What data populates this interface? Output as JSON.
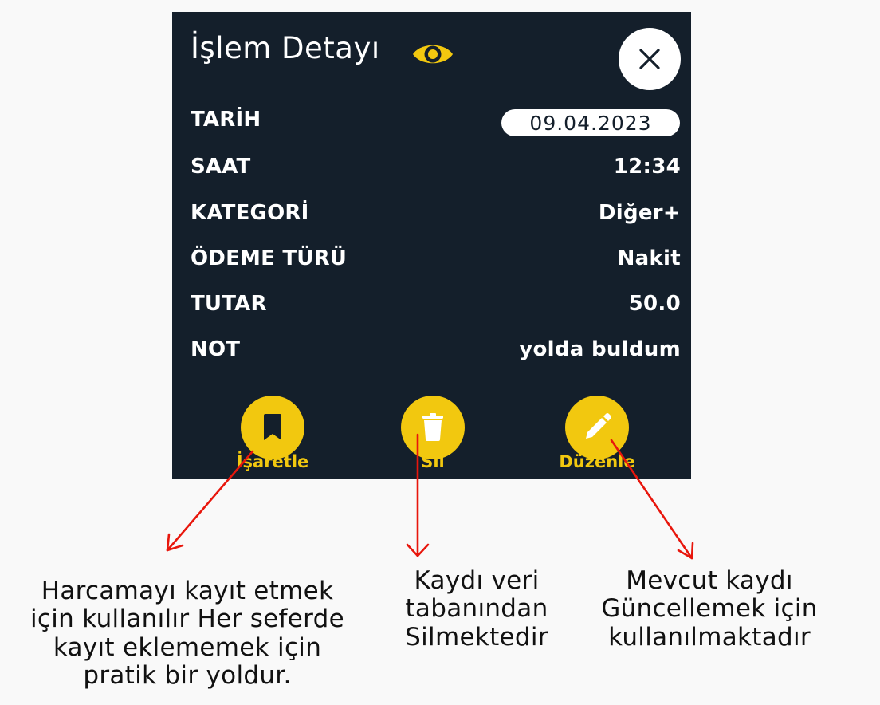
{
  "dialog": {
    "title": "İşlem Detayı",
    "close_icon": "close-icon",
    "eye_icon": "eye-icon",
    "accent_color": "#f2c80f",
    "background_color": "#141f2b"
  },
  "fields": [
    {
      "label": "TARİH",
      "value": "09.04.2023"
    },
    {
      "label": "SAAT",
      "value": "12:34"
    },
    {
      "label": "KATEGORİ",
      "value": "Diğer+"
    },
    {
      "label": "ÖDEME TÜRÜ",
      "value": "Nakit"
    },
    {
      "label": "TUTAR",
      "value": "50.0"
    },
    {
      "label": "NOT",
      "value": "yolda buldum"
    }
  ],
  "actions": [
    {
      "label": "İşaretle",
      "icon": "bookmark-icon"
    },
    {
      "label": "Sil",
      "icon": "trash-icon"
    },
    {
      "label": "Düzenle",
      "icon": "pencil-icon"
    }
  ],
  "annotations": [
    {
      "text": "Harcamayı kayıt etmek\niçin kullanılır Her seferde\nkayıt eklememek için\npratik bir yoldur."
    },
    {
      "text": "Kaydı  veri\ntabanından\nSilmektedir"
    },
    {
      "text": "Mevcut kaydı\nGüncellemek için\nkullanılmaktadır"
    }
  ],
  "arrow_color": "#e8160c"
}
